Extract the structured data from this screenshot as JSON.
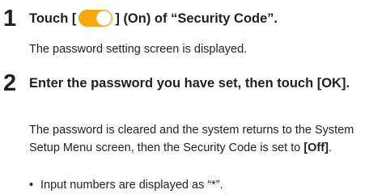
{
  "step1": {
    "number": "1",
    "head_prefix": "Touch [",
    "head_suffix": "] (On) of “Security Code”.",
    "toggle_state": "on",
    "toggle_color": "#f5a70f",
    "desc": "The password setting screen is displayed."
  },
  "step2": {
    "number": "2",
    "head": "Enter the password you have set, then touch [OK].",
    "desc_main": "The password is cleared and the system returns to the System Setup Menu screen, then the Security Code is set to ",
    "desc_bold": "[Off]",
    "desc_end": ".",
    "bullet": "•",
    "note": "Input numbers are displayed as “*”."
  }
}
